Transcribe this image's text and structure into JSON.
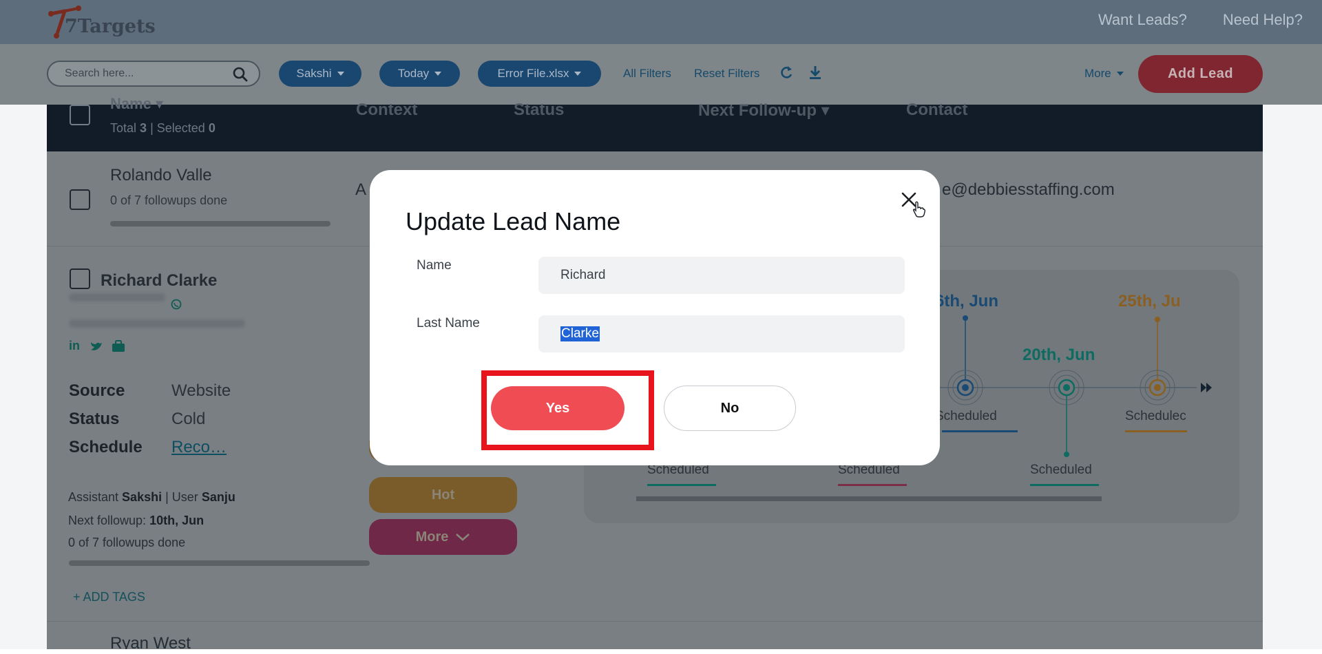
{
  "header": {
    "logo_text": "7Targets",
    "nav": [
      "Want Leads?",
      "Need Help?"
    ]
  },
  "filters": {
    "search_placeholder": "Search here...",
    "assistant": "Sakshi",
    "date": "Today",
    "file": "Error File.xlsx",
    "all_filters": "All Filters",
    "reset_filters": "Reset Filters",
    "more": "More",
    "add_lead": "Add Lead"
  },
  "table": {
    "columns": [
      "Name",
      "Context",
      "Status",
      "Next Follow-up",
      "Contact"
    ],
    "total_label": "Total",
    "total": "3",
    "selected_label": "Selected",
    "selected": "0"
  },
  "leads": {
    "row1": {
      "name": "Rolando Valle",
      "followups": "0 of 7 followups done",
      "context_start": "A",
      "email": "e@debbiesstaffing.com"
    },
    "row2": {
      "name": "Richard Clarke",
      "source_key": "Source",
      "source_val": "Website",
      "status_key": "Status",
      "status_val": "Cold",
      "schedule_key": "Schedule",
      "schedule_val": "Reco…",
      "assistant_label": "Assistant",
      "assistant": "Sakshi",
      "user_label": "User",
      "user": "Sanju",
      "next_label": "Next followup:",
      "next": "10th, Jun",
      "followups": "0 of 7 followups done",
      "add_tags": "+ ADD TAGS",
      "hot_button": "Hot",
      "more_button": "More"
    },
    "row3": {
      "name": "Ryan West"
    }
  },
  "timeline": {
    "dates": [
      "6th, Jun",
      "20th, Jun",
      "25th, Ju"
    ],
    "scheduled_label": "Scheduled",
    "scheduled_cut": "Schedulec",
    "scheduled_left_cut": "Scheduled",
    "colors": {
      "blue": "#1a4a73",
      "teal": "#0e6b62",
      "orange": "#8a5f22",
      "pink": "#7a2f47"
    }
  },
  "modal": {
    "title": "Update Lead Name",
    "name_label": "Name",
    "name_value": "Richard",
    "last_name_label": "Last Name",
    "last_name_value": "Clarke",
    "yes": "Yes",
    "no": "No"
  },
  "colors": {
    "accent_red": "#ef4c53",
    "highlight": "#e8141c",
    "selection": "#1f63d6"
  }
}
